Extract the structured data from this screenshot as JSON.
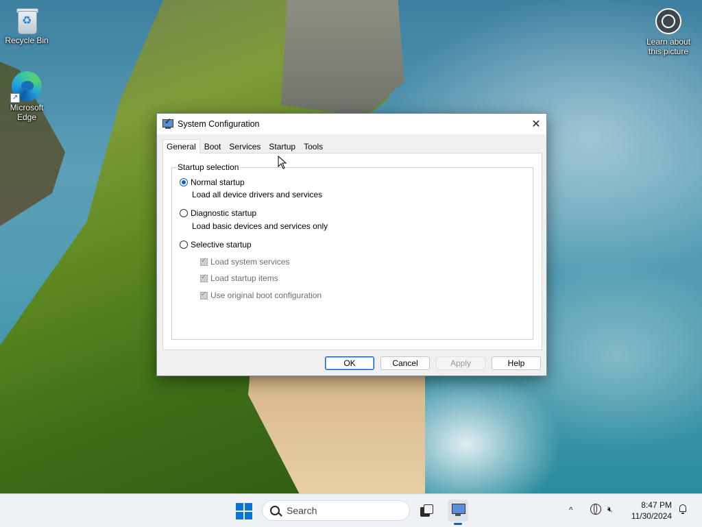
{
  "desktop": {
    "icons": [
      {
        "label": "Recycle Bin"
      },
      {
        "label": "Microsoft Edge"
      },
      {
        "label": "Learn about this picture"
      }
    ]
  },
  "dialog": {
    "title": "System Configuration",
    "close_glyph": "✕",
    "tabs": [
      {
        "label": "General",
        "active": true
      },
      {
        "label": "Boot"
      },
      {
        "label": "Services"
      },
      {
        "label": "Startup"
      },
      {
        "label": "Tools"
      }
    ],
    "group_label": "Startup selection",
    "options": [
      {
        "label": "Normal startup",
        "description": "Load all device drivers and services",
        "selected": true
      },
      {
        "label": "Diagnostic startup",
        "description": "Load basic devices and services only",
        "selected": false
      },
      {
        "label": "Selective startup",
        "selected": false
      }
    ],
    "selective_items": [
      {
        "label": "Load system services",
        "checked": true,
        "enabled": false
      },
      {
        "label": "Load startup items",
        "checked": true,
        "enabled": false
      },
      {
        "label": "Use original boot configuration",
        "checked": true,
        "enabled": false
      }
    ],
    "buttons": {
      "ok": "OK",
      "cancel": "Cancel",
      "apply": "Apply",
      "help": "Help"
    }
  },
  "taskbar": {
    "search_placeholder": "Search",
    "time": "8:47 PM",
    "date": "11/30/2024",
    "tray_chevron": "^"
  },
  "colors": {
    "accent": "#0a5fc4",
    "start_blue": "#0a74d6",
    "dialog_bg": "#f0f0f0"
  }
}
